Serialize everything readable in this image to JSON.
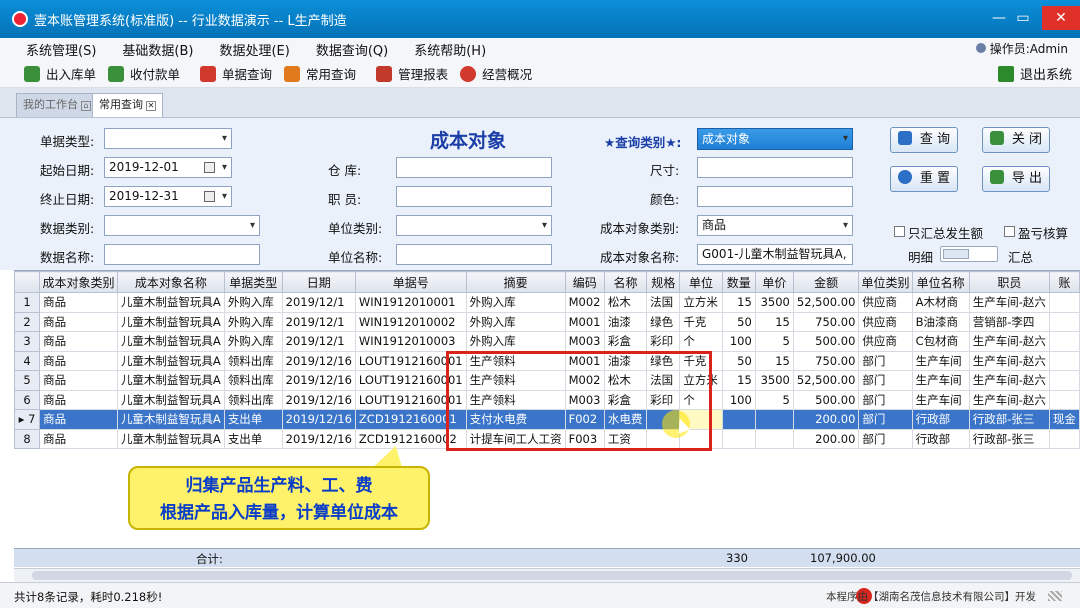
{
  "titlebar": {
    "title": "壹本账管理系统(标准版) -- 行业数据演示 -- L生产制造",
    "minimize": "—",
    "maximize": "▭",
    "close": "✕"
  },
  "menu": [
    "系统管理(S)",
    "基础数据(B)",
    "数据处理(E)",
    "数据查询(Q)",
    "系统帮助(H)"
  ],
  "operator": "操作员:Admin",
  "toolbar": [
    {
      "label": "出入库单",
      "icon": "stock-icon",
      "color": "#3a8f3a"
    },
    {
      "label": "收付款单",
      "icon": "payment-icon",
      "color": "#3a8f3a"
    },
    {
      "label": "单据查询",
      "icon": "document-query-icon",
      "color": "#d1392d"
    },
    {
      "label": "常用查询",
      "icon": "common-query-icon",
      "color": "#e07a1d"
    },
    {
      "label": "管理报表",
      "icon": "report-icon",
      "color": "#c0392b"
    },
    {
      "label": "经营概况",
      "icon": "overview-icon",
      "color": "#d1392d"
    }
  ],
  "exit_label": "退出系统",
  "tabs": {
    "workbench": "我的工作台",
    "current": "常用查询"
  },
  "form": {
    "title": "成本对象",
    "doc_type_label": "单据类型:",
    "doc_type_value": "",
    "start_date_label": "起始日期:",
    "start_date": "2019-12-01",
    "end_date_label": "终止日期:",
    "end_date": "2019-12-31",
    "data_type_label": "数据类别:",
    "data_type_value": "",
    "data_name_label": "数据名称:",
    "data_name_value": "",
    "warehouse_label": "仓    库:",
    "staff_label": "职    员:",
    "unit_type_label": "单位类别:",
    "unit_name_label": "单位名称:",
    "query_type_label": "★查询类别★:",
    "query_type_value": "成本对象",
    "size_label": "尺寸:",
    "color_label": "颜色:",
    "cost_type_label": "成本对象类别:",
    "cost_type_value": "商品",
    "cost_name_label": "成本对象名称:",
    "cost_name_value": "G001-儿童木制益智玩具A,",
    "btn_query": "查 询",
    "btn_close": "关 闭",
    "btn_reset": "重 置",
    "btn_export": "导 出",
    "chk_only_summary": "只汇总发生额",
    "chk_profit_loss": "盈亏核算",
    "detail_label": "明细",
    "summary_label": "汇总"
  },
  "table": {
    "headers": [
      "成本对象类别",
      "成本对象名称",
      "单据类型",
      "日期",
      "单据号",
      "摘要",
      "编码",
      "名称",
      "规格",
      "单位",
      "数量",
      "单价",
      "金额",
      "单位类别",
      "单位名称",
      "职员",
      "账"
    ],
    "rows": [
      [
        "1",
        "商品",
        "儿童木制益智玩具A",
        "外购入库",
        "2019/12/1",
        "WIN1912010001",
        "外购入库",
        "M002",
        "松木",
        "法国",
        "立方米",
        "15",
        "3500",
        "52,500.00",
        "供应商",
        "A木材商",
        "生产车间-赵六",
        ""
      ],
      [
        "2",
        "商品",
        "儿童木制益智玩具A",
        "外购入库",
        "2019/12/1",
        "WIN1912010002",
        "外购入库",
        "M001",
        "油漆",
        "绿色",
        "千克",
        "50",
        "15",
        "750.00",
        "供应商",
        "B油漆商",
        "营销部-李四",
        ""
      ],
      [
        "3",
        "商品",
        "儿童木制益智玩具A",
        "外购入库",
        "2019/12/1",
        "WIN1912010003",
        "外购入库",
        "M003",
        "彩盒",
        "彩印",
        "个",
        "100",
        "5",
        "500.00",
        "供应商",
        "C包材商",
        "生产车间-赵六",
        ""
      ],
      [
        "4",
        "商品",
        "儿童木制益智玩具A",
        "领料出库",
        "2019/12/16",
        "LOUT1912160001",
        "生产领料",
        "M001",
        "油漆",
        "绿色",
        "千克",
        "50",
        "15",
        "750.00",
        "部门",
        "生产车间",
        "生产车间-赵六",
        ""
      ],
      [
        "5",
        "商品",
        "儿童木制益智玩具A",
        "领料出库",
        "2019/12/16",
        "LOUT1912160001",
        "生产领料",
        "M002",
        "松木",
        "法国",
        "立方米",
        "15",
        "3500",
        "52,500.00",
        "部门",
        "生产车间",
        "生产车间-赵六",
        ""
      ],
      [
        "6",
        "商品",
        "儿童木制益智玩具A",
        "领料出库",
        "2019/12/16",
        "LOUT1912160001",
        "生产领料",
        "M003",
        "彩盒",
        "彩印",
        "个",
        "100",
        "5",
        "500.00",
        "部门",
        "生产车间",
        "生产车间-赵六",
        ""
      ],
      [
        "7",
        "商品",
        "儿童木制益智玩具A",
        "支出单",
        "2019/12/16",
        "ZCD1912160001",
        "支付水电费",
        "F002",
        "水电费",
        "",
        "",
        "",
        "",
        "200.00",
        "部门",
        "行政部",
        "行政部-张三",
        "现金"
      ],
      [
        "8",
        "商品",
        "儿童木制益智玩具A",
        "支出单",
        "2019/12/16",
        "ZCD1912160002",
        "计提车间工人工资",
        "F003",
        "工资",
        "",
        "",
        "",
        "",
        "200.00",
        "部门",
        "行政部",
        "行政部-张三",
        ""
      ]
    ],
    "selected_row": 7,
    "row_marker": "▸"
  },
  "footer": {
    "label": "合计:",
    "qty_total": "330",
    "amount_total": "107,900.00"
  },
  "callout": {
    "line1": "归集产品生产料、工、费",
    "line2": "根据产品入库量，计算单位成本"
  },
  "status": {
    "left": "共计8条记录，耗时0.218秒!",
    "right": "本程序由【湖南名茂信息技术有限公司】开发"
  }
}
